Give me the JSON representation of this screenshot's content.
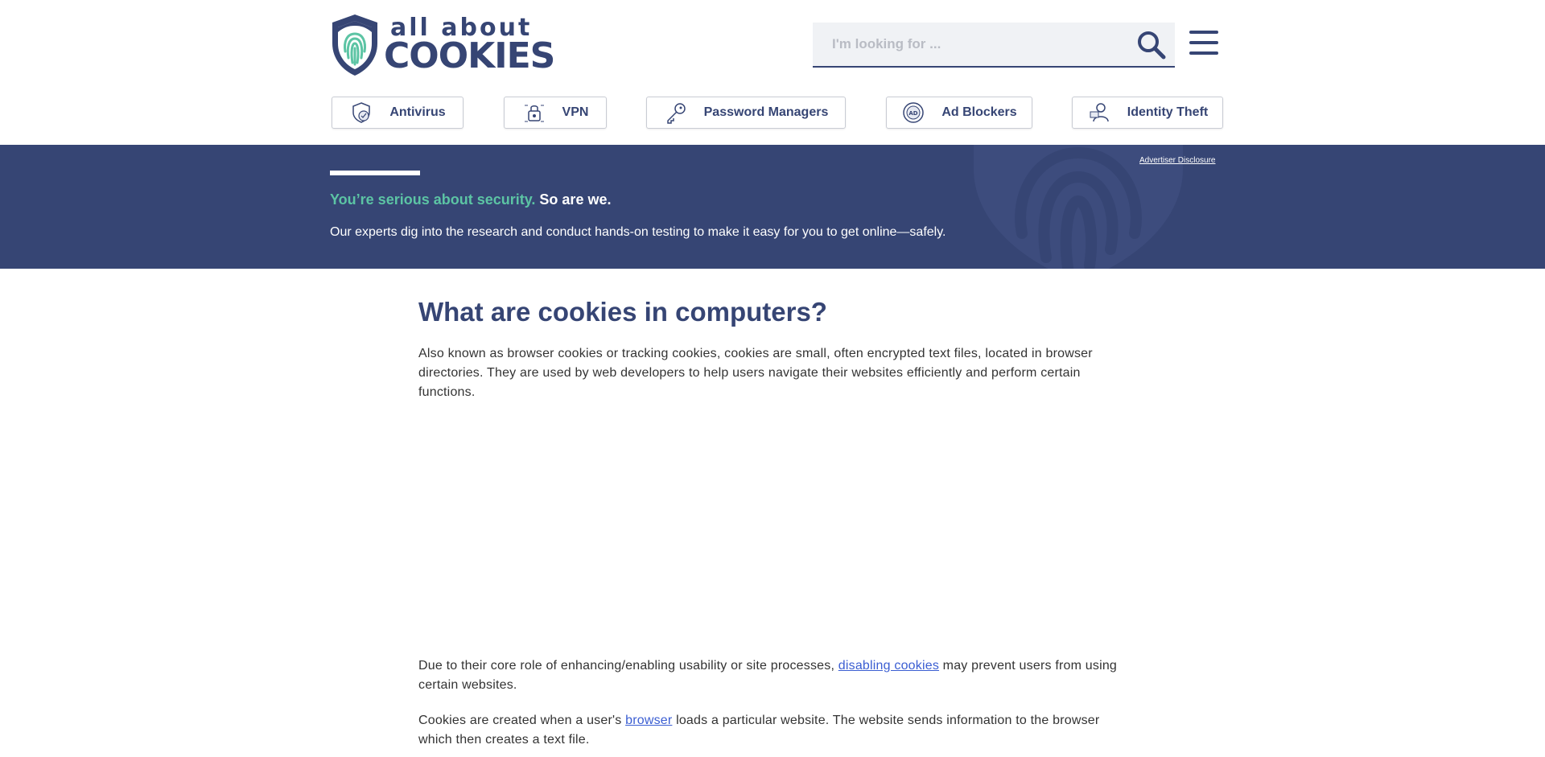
{
  "header": {
    "logo_top": "all about",
    "logo_bottom": "COOKIES",
    "search_placeholder": "I'm looking for ..."
  },
  "categories": [
    {
      "label": "Antivirus",
      "icon": "antivirus-shield-icon"
    },
    {
      "label": "VPN",
      "icon": "vpn-lock-icon"
    },
    {
      "label": "Password Managers",
      "icon": "key-icon"
    },
    {
      "label": "Ad Blockers",
      "icon": "ad-blocker-icon"
    },
    {
      "label": "Identity Theft",
      "icon": "identity-theft-icon"
    }
  ],
  "hero": {
    "tagline_accent": "You’re serious about security.",
    "tagline_white": "So are we.",
    "subtitle": "Our experts dig into the research and conduct hands-on testing to make it easy for you to get online—safely.",
    "disclosure": "Advertiser Disclosure"
  },
  "article": {
    "title": "What are cookies in computers?",
    "p1": "Also known as browser cookies or tracking cookies, cookies are small, often encrypted text files, located in browser directories. They are used by web developers to help users navigate their websites efficiently and perform certain functions.",
    "p2_before": "Due to their core role of enhancing/enabling usability or site processes, ",
    "p2_link": "disabling cookies",
    "p2_after": " may prevent users from using certain websites.",
    "p3_before": "Cookies are created when a user's ",
    "p3_link": "browser",
    "p3_after": " loads a particular website. The website sends information to the browser which then creates a text file."
  },
  "colors": {
    "brand_navy": "#364574",
    "accent_green": "#5cc4a4",
    "link_blue": "#3b5ed2"
  }
}
